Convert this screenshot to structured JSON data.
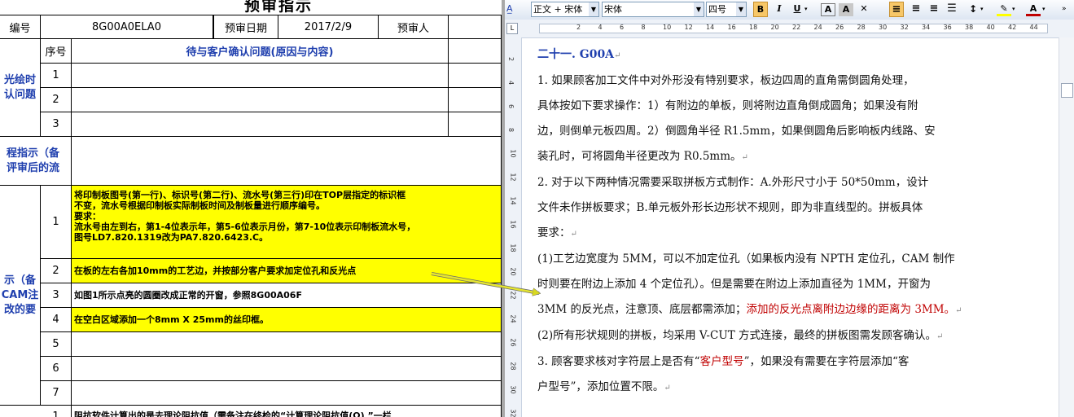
{
  "sheet": {
    "title": "预审指示",
    "header": {
      "label_no": "编号",
      "order_no": "8G00A0ELA0",
      "label_date": "预审日期",
      "date": "2017/2/9",
      "label_reviewer": "预审人"
    },
    "confirm": {
      "col_seq": "序号",
      "col_content": "待与客户确认问题(原因与内容)",
      "section_label": "光绘时认问题",
      "rows": [
        "1",
        "2",
        "3"
      ]
    },
    "process_label": "程指示（备\n评审后的流",
    "change_label": "示（备\nCAM注\n改的要",
    "instructions": [
      {
        "seq": "1",
        "text": "将印制板图号(第一行)、标识号(第二行)、流水号(第三行)印在TOP层指定的标识框\n不变，流水号根据印制板实际制板时间及制板量进行顺序编号。\n要求：\n流水号由左到右，第1-4位表示年，第5-6位表示月份，第7-10位表示印制板流水号，\n图号LD7.820.1319改为PA7.820.6423.C。",
        "highlight": true
      },
      {
        "seq": "2",
        "text": "在板的左右各加10mm的工艺边，并按部分客户要求加定位孔和反光点",
        "highlight": true
      },
      {
        "seq": "3",
        "text": "如图1所示点亮的圆圈改成正常的开窗，参照8G00A06F",
        "highlight": false
      },
      {
        "seq": "4",
        "text": "在空白区域添加一个8mm X 25mm的丝印框。",
        "highlight": true
      },
      {
        "seq": "5",
        "text": "",
        "highlight": false
      },
      {
        "seq": "6",
        "text": "",
        "highlight": false
      },
      {
        "seq": "7",
        "text": "",
        "highlight": false
      }
    ],
    "bottom_row": {
      "seq": "1",
      "text": "阻抗软件计算出的是去理论阻抗值（需备注在终检的“计算理论阻抗值(Ω)  ”一栏"
    }
  },
  "word": {
    "toolbar": {
      "style": "正文 + 宋体",
      "font": "宋体",
      "size": "四号"
    },
    "ruler_numbers": [
      "2",
      "4",
      "6",
      "8",
      "10",
      "12",
      "14",
      "16",
      "18",
      "20",
      "22",
      "24",
      "26",
      "28",
      "30",
      "32",
      "34",
      "36",
      "38",
      "40",
      "42",
      "44"
    ],
    "vruler_numbers": [
      "2",
      "4",
      "6",
      "8",
      "10",
      "12",
      "14",
      "16",
      "18",
      "20",
      "22",
      "24",
      "26",
      "28",
      "30",
      "32"
    ],
    "doc": {
      "heading": "二十一. G00A",
      "lines": [
        "1. 如果顾客加工文件中对外形没有特别要求，板边四周的直角需倒圆角处理，",
        "具体按如下要求操作：1）有附边的单板，则将附边直角倒成圆角；如果没有附",
        "边，则倒单元板四周。2）倒圆角半径 R1.5mm，如果倒圆角后影响板内线路、安",
        "装孔时，可将圆角半径更改为 R0.5mm。",
        "2. 对于以下两种情况需要采取拼板方式制作：A.外形尺寸小于 50*50mm，设计",
        "文件未作拼板要求；B.单元板外形长边形状不规则，即为非直线型的。拼板具体",
        "要求：",
        "(1)工艺边宽度为 5MM，可以不加定位孔（如果板内没有 NPTH 定位孔，CAM 制作",
        "时则要在附边上添加 4 个定位孔）。但是需要在附边上添加直径为 1MM，开窗为",
        "3MM 的反光点，注意顶、底层都需添加；"
      ],
      "red_text": "添加的反光点离附边边缘的距离为 3MM。",
      "lines2": [
        "(2)所有形状规则的拼板，均采用 V-CUT 方式连接，最终的拼板图需发顾客确认。",
        "3. 顾客要求核对字符层上是否有“"
      ],
      "red_text2": "客户型号",
      "line_after_red2": "”，如果没有需要在字符层添加“客",
      "last_line": "户型号”，添加位置不限。"
    }
  }
}
